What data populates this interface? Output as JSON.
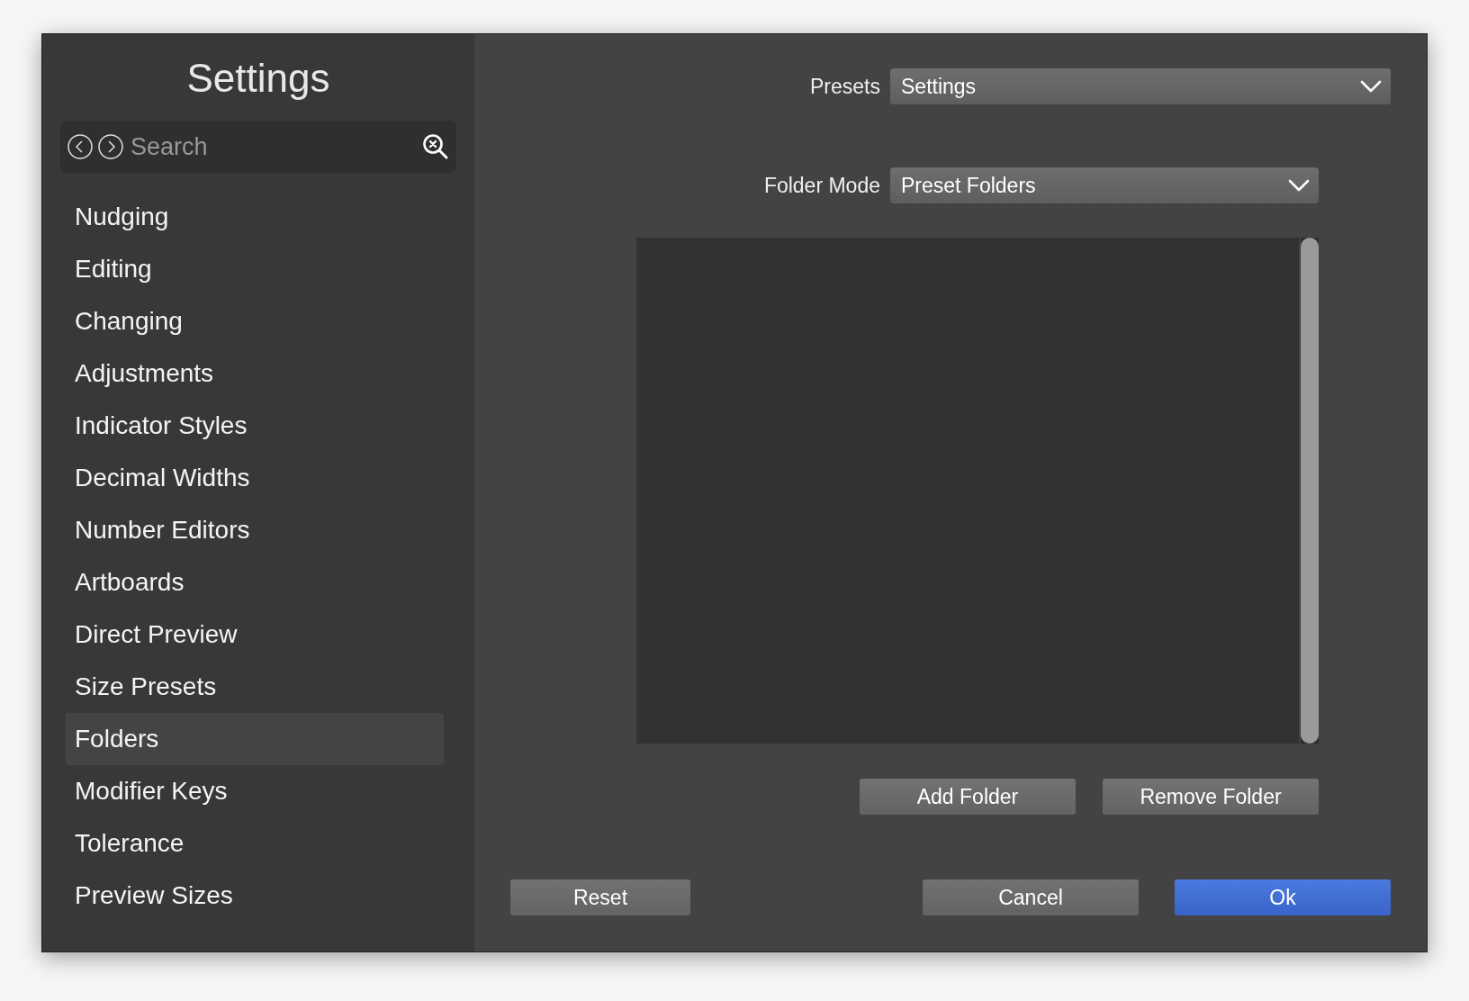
{
  "sidebar": {
    "title": "Settings",
    "search": {
      "placeholder": "Search"
    },
    "items": [
      {
        "label": "Nudging",
        "selected": false
      },
      {
        "label": "Editing",
        "selected": false
      },
      {
        "label": "Changing",
        "selected": false
      },
      {
        "label": "Adjustments",
        "selected": false
      },
      {
        "label": "Indicator Styles",
        "selected": false
      },
      {
        "label": "Decimal Widths",
        "selected": false
      },
      {
        "label": "Number Editors",
        "selected": false
      },
      {
        "label": "Artboards",
        "selected": false
      },
      {
        "label": "Direct Preview",
        "selected": false
      },
      {
        "label": "Size Presets",
        "selected": false
      },
      {
        "label": "Folders",
        "selected": true
      },
      {
        "label": "Modifier Keys",
        "selected": false
      },
      {
        "label": "Tolerance",
        "selected": false
      },
      {
        "label": "Preview Sizes",
        "selected": false
      }
    ]
  },
  "presets": {
    "label": "Presets",
    "value": "Settings"
  },
  "folder_mode": {
    "label": "Folder Mode",
    "value": "Preset Folders"
  },
  "folder_buttons": [
    "Add Folder",
    "Remove Folder"
  ],
  "footer_buttons": [
    {
      "label": "Reset",
      "kind": "secondary"
    },
    {
      "label": "Cancel",
      "kind": "secondary"
    },
    {
      "label": "Ok",
      "kind": "primary"
    }
  ]
}
